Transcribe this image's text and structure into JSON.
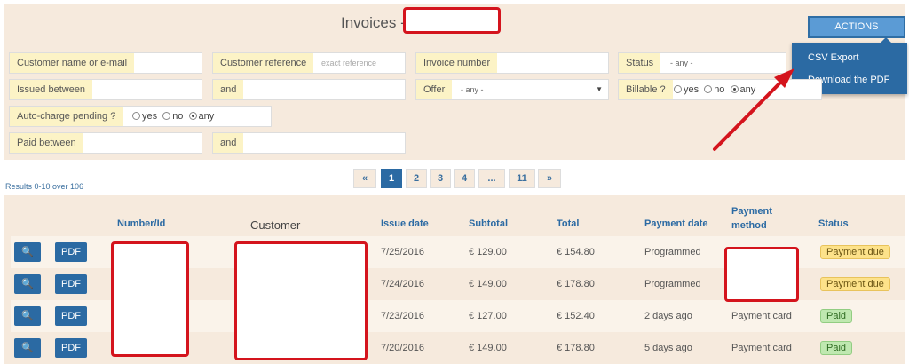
{
  "header": {
    "title": "Invoices -",
    "actions_label": "ACTIONS"
  },
  "actions_menu": [
    {
      "label": "CSV Export"
    },
    {
      "label": "Download the PDF"
    }
  ],
  "filters": {
    "customer": {
      "label": "Customer name or e-mail",
      "value": ""
    },
    "customer_reference": {
      "label": "Customer reference",
      "placeholder": "exact reference"
    },
    "invoice_number": {
      "label": "Invoice number",
      "value": ""
    },
    "status": {
      "label": "Status",
      "selected": "- any -"
    },
    "issued_between": {
      "label": "Issued between",
      "value": ""
    },
    "issued_and": {
      "label": "and",
      "value": ""
    },
    "offer": {
      "label": "Offer",
      "selected": "- any -"
    },
    "billable": {
      "label": "Billable ?",
      "options": [
        "yes",
        "no",
        "any"
      ],
      "selected": "any"
    },
    "auto_charge": {
      "label": "Auto-charge pending ?",
      "options": [
        "yes",
        "no",
        "any"
      ],
      "selected": "any"
    },
    "paid_between": {
      "label": "Paid between",
      "value": ""
    },
    "paid_and": {
      "label": "and",
      "value": ""
    }
  },
  "results_text": "Results 0-10 over 106",
  "pagination": [
    "«",
    "1",
    "2",
    "3",
    "4",
    "...",
    "11",
    "»"
  ],
  "pagination_active": "1",
  "table": {
    "columns": [
      "Number/Id",
      "Customer",
      "Issue date",
      "Subtotal",
      "Total",
      "Payment date",
      "Payment method",
      "Status"
    ],
    "button_pdf": "PDF",
    "rows": [
      {
        "issue_date": "7/25/2016",
        "subtotal": "€ 129.00",
        "total": "€ 154.80",
        "payment_date": "Programmed",
        "payment_method": "",
        "status": "Payment due"
      },
      {
        "issue_date": "7/24/2016",
        "subtotal": "€ 149.00",
        "total": "€ 178.80",
        "payment_date": "Programmed",
        "payment_method": "",
        "status": "Payment due"
      },
      {
        "issue_date": "7/23/2016",
        "subtotal": "€ 127.00",
        "total": "€ 152.40",
        "payment_date": "2 days ago",
        "payment_method": "Payment card",
        "status": "Paid"
      },
      {
        "issue_date": "7/20/2016",
        "subtotal": "€ 149.00",
        "total": "€ 178.80",
        "payment_date": "5 days ago",
        "payment_method": "Payment card",
        "status": "Paid"
      }
    ]
  },
  "colors": {
    "accent": "#2b6aa3",
    "panel": "#f6eadd",
    "label_bg": "#fcf3c6",
    "redact_border": "#d4141d",
    "arrow": "#d4141d"
  }
}
